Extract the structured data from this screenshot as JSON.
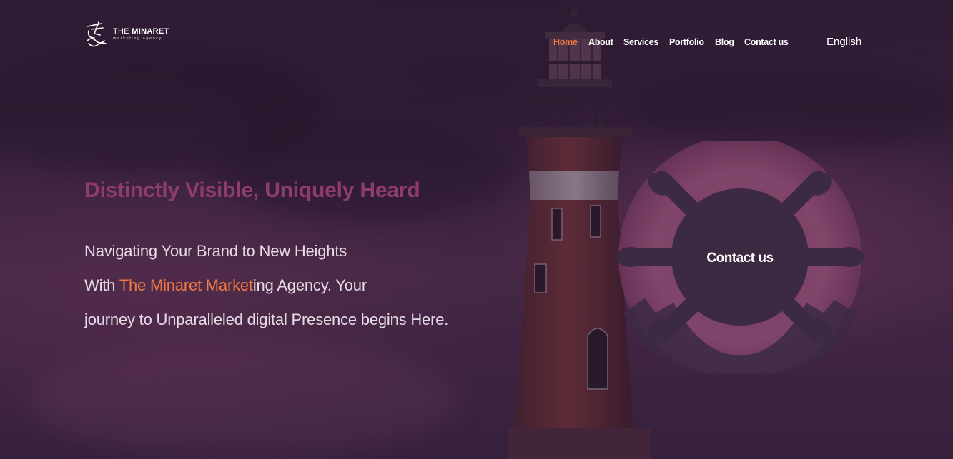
{
  "logo": {
    "name_prefix": "THE ",
    "name_bold": "MINARET",
    "subtitle": "marketing agency"
  },
  "nav": {
    "items": [
      {
        "label": "Home",
        "active": true
      },
      {
        "label": "About"
      },
      {
        "label": "Services"
      },
      {
        "label": "Portfolio"
      },
      {
        "label": "Blog"
      },
      {
        "label": "Contact us"
      }
    ],
    "language": "English"
  },
  "hero": {
    "tagline": "Distinctly Visible, Uniquely Heard",
    "line1": "Navigating Your Brand to New Heights",
    "line2_pre": "With ",
    "line2_accent": "The Minaret Market",
    "line2_post": "ing Agency. Your",
    "line3": "journey to Unparalleled digital Presence begins Here."
  },
  "cta": {
    "label": "Contact us"
  },
  "colors": {
    "accent": "#f07a3c",
    "tagline": "#8e3c6b",
    "background": "#3a2438"
  }
}
